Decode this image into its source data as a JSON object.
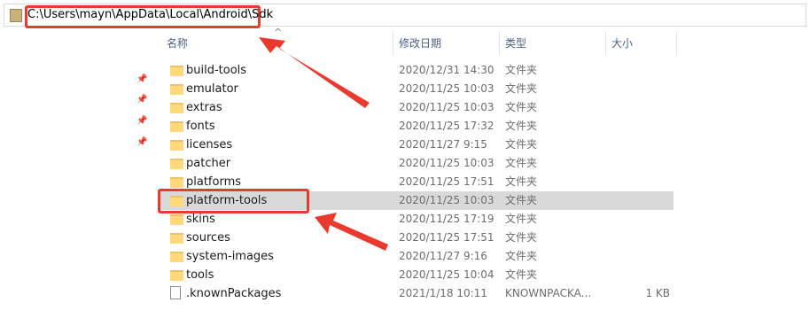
{
  "address_bar": {
    "path": "C:\\Users\\mayn\\AppData\\Local\\Android\\Sdk",
    "icon": "folder-icon"
  },
  "columns": {
    "name": "名称",
    "modified": "修改日期",
    "type": "类型",
    "size": "大小"
  },
  "files": [
    {
      "name": "build-tools",
      "modified": "2020/12/31 14:30",
      "type": "文件夹",
      "size": "",
      "icon": "folder-icon"
    },
    {
      "name": "emulator",
      "modified": "2020/11/25 10:03",
      "type": "文件夹",
      "size": "",
      "icon": "folder-icon"
    },
    {
      "name": "extras",
      "modified": "2020/11/25 10:03",
      "type": "文件夹",
      "size": "",
      "icon": "folder-icon"
    },
    {
      "name": "fonts",
      "modified": "2020/11/25 17:32",
      "type": "文件夹",
      "size": "",
      "icon": "folder-icon"
    },
    {
      "name": "licenses",
      "modified": "2020/11/27 9:15",
      "type": "文件夹",
      "size": "",
      "icon": "folder-icon"
    },
    {
      "name": "patcher",
      "modified": "2020/11/25 10:03",
      "type": "文件夹",
      "size": "",
      "icon": "folder-icon"
    },
    {
      "name": "platforms",
      "modified": "2020/11/25 17:51",
      "type": "文件夹",
      "size": "",
      "icon": "folder-icon"
    },
    {
      "name": "platform-tools",
      "modified": "2020/11/25 10:03",
      "type": "文件夹",
      "size": "",
      "icon": "folder-icon",
      "selected": true
    },
    {
      "name": "skins",
      "modified": "2020/11/25 17:19",
      "type": "文件夹",
      "size": "",
      "icon": "folder-icon"
    },
    {
      "name": "sources",
      "modified": "2020/11/25 17:51",
      "type": "文件夹",
      "size": "",
      "icon": "folder-icon"
    },
    {
      "name": "system-images",
      "modified": "2020/11/27 9:16",
      "type": "文件夹",
      "size": "",
      "icon": "folder-icon"
    },
    {
      "name": "tools",
      "modified": "2020/11/25 10:04",
      "type": "文件夹",
      "size": "",
      "icon": "folder-icon"
    },
    {
      "name": ".knownPackages",
      "modified": "2021/1/18 10:11",
      "type": "KNOWNPACKA...",
      "size": "1 KB",
      "icon": "file-icon"
    }
  ],
  "quick_access_pins": [
    "pin-icon",
    "pin-icon",
    "pin-icon",
    "pin-icon"
  ],
  "annotation_color": "#ea3a2e"
}
